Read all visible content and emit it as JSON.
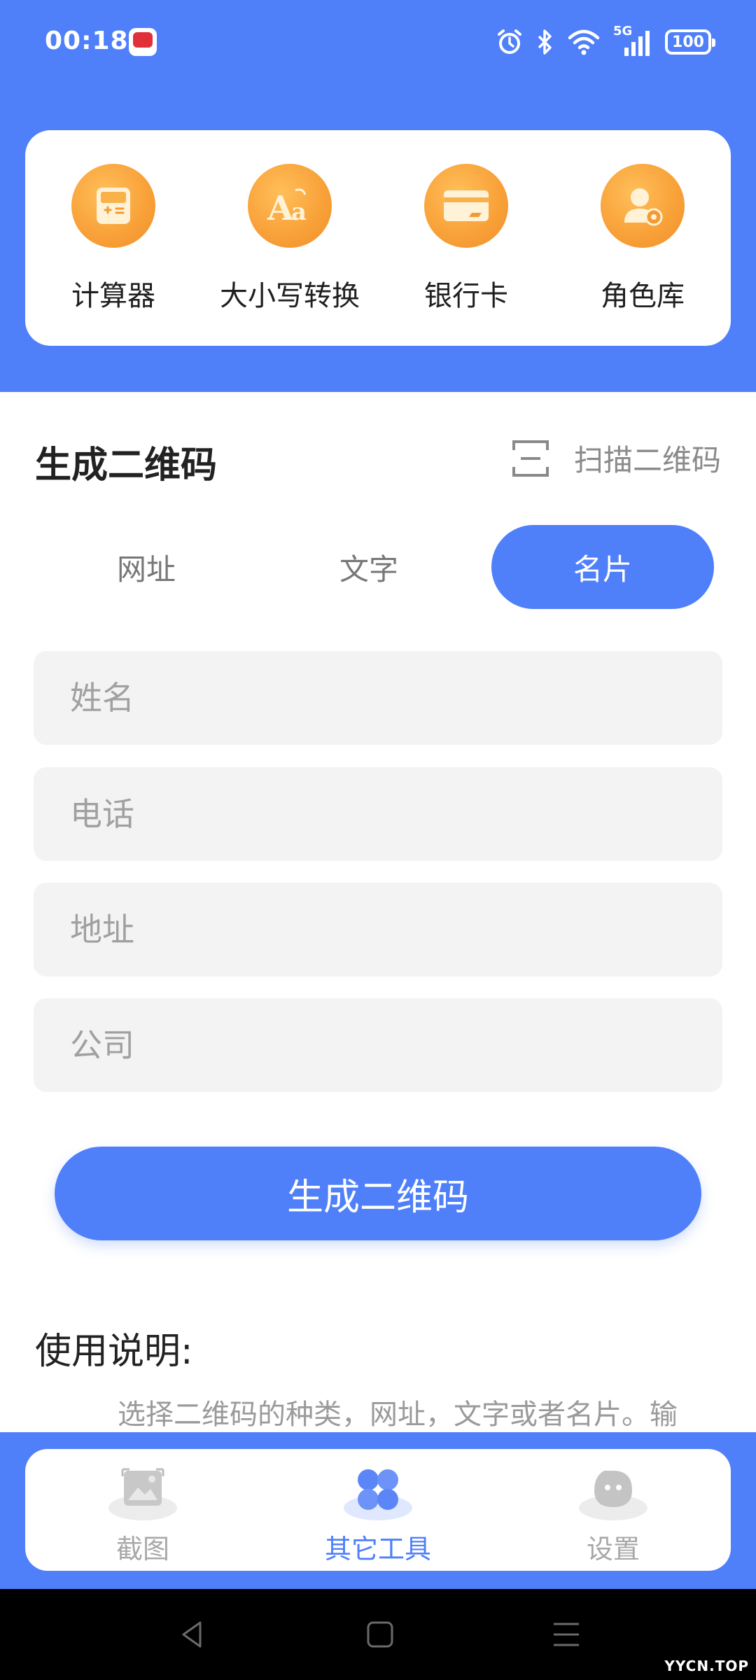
{
  "status_bar": {
    "time": "00:18",
    "network": "5G",
    "battery": "100"
  },
  "tools": [
    {
      "label": "计算器",
      "icon": "calculator-icon"
    },
    {
      "label": "大小写转换",
      "icon": "text-case-icon"
    },
    {
      "label": "银行卡",
      "icon": "bank-card-icon"
    },
    {
      "label": "角色库",
      "icon": "role-library-icon"
    }
  ],
  "qr": {
    "title": "生成二维码",
    "scan_label": "扫描二维码",
    "tabs": [
      "网址",
      "文字",
      "名片"
    ],
    "active_tab": "名片",
    "fields": {
      "name_placeholder": "姓名",
      "phone_placeholder": "电话",
      "address_placeholder": "地址",
      "company_placeholder": "公司"
    },
    "generate_label": "生成二维码"
  },
  "usage": {
    "title": "使用说明:",
    "text": "选择二维码的种类，网址，文字或者名片。输"
  },
  "bottom_nav": [
    {
      "label": "截图",
      "icon": "screenshot-icon"
    },
    {
      "label": "其它工具",
      "icon": "tools-grid-icon"
    },
    {
      "label": "设置",
      "icon": "settings-face-icon"
    }
  ],
  "watermark": "YYCN.TOP",
  "colors": {
    "primary": "#4f80fa",
    "accent_orange": "#f9a23a"
  }
}
